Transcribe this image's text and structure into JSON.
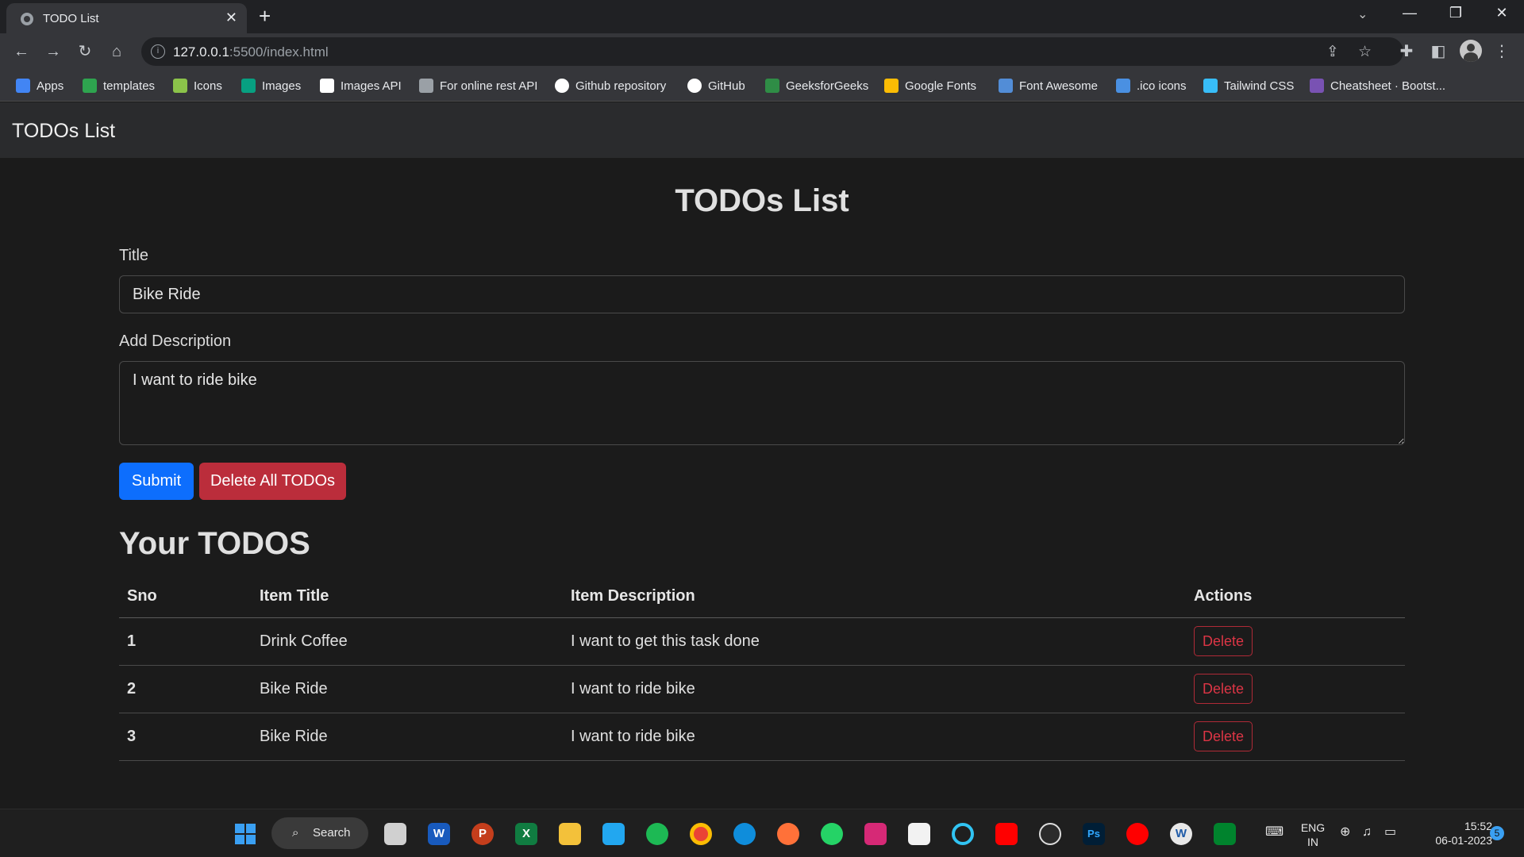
{
  "browser": {
    "tab_title": "TODO List",
    "url_host": "127.0.0.1",
    "url_path": ":5500/index.html"
  },
  "bookmarks": [
    {
      "label": "Apps",
      "icon": "apps-grid-icon",
      "color": "#4285f4"
    },
    {
      "label": "templates",
      "icon": "templates-icon",
      "color": "#2ea44f"
    },
    {
      "label": "Icons",
      "icon": "icons-site-icon",
      "color": "#8bc34a"
    },
    {
      "label": "Images",
      "icon": "pexels-icon",
      "color": "#07a081"
    },
    {
      "label": "Images API",
      "icon": "unsplash-icon",
      "color": "#ffffff"
    },
    {
      "label": "For online rest API",
      "icon": "api-icon",
      "color": "#9aa0a6"
    },
    {
      "label": "Github repository",
      "icon": "github-icon",
      "color": "#ffffff"
    },
    {
      "label": "GitHub",
      "icon": "github-icon",
      "color": "#ffffff"
    },
    {
      "label": "GeeksforGeeks",
      "icon": "geeksforgeeks-icon",
      "color": "#2f8d46"
    },
    {
      "label": "Google Fonts",
      "icon": "google-fonts-icon",
      "color": "#fbbc04"
    },
    {
      "label": "Font Awesome",
      "icon": "font-awesome-flag-icon",
      "color": "#528dd7"
    },
    {
      "label": ".ico icons",
      "icon": "ico-icons-icon",
      "color": "#4a90e2"
    },
    {
      "label": "Tailwind CSS",
      "icon": "tailwind-icon",
      "color": "#38bdf8"
    },
    {
      "label": "Cheatsheet · Bootst...",
      "icon": "bootstrap-icon",
      "color": "#7952b3"
    }
  ],
  "app": {
    "brand": "TODOs List",
    "heading": "TODOs List",
    "title_label": "Title",
    "title_value": "Bike Ride",
    "desc_label": "Add Description",
    "desc_value": "I want to ride bike",
    "submit_label": "Submit",
    "delete_all_label": "Delete All TODOs",
    "list_heading": "Your TODOS",
    "columns": [
      "Sno",
      "Item Title",
      "Item Description",
      "Actions"
    ],
    "rows": [
      {
        "sno": "1",
        "title": "Drink Coffee",
        "desc": "I want to get this task done",
        "action": "Delete"
      },
      {
        "sno": "2",
        "title": "Bike Ride",
        "desc": "I want to ride bike",
        "action": "Delete"
      },
      {
        "sno": "3",
        "title": "Bike Ride",
        "desc": "I want to ride bike",
        "action": "Delete"
      }
    ],
    "colors": {
      "primary": "#0d6efd",
      "danger": "#bb2d3b",
      "danger_text": "#dc3545"
    }
  },
  "taskbar": {
    "search_label": "Search",
    "apps": [
      {
        "name": "windows-start-icon",
        "glyph": "",
        "color": "#3aa0f3"
      },
      {
        "name": "task-view-icon",
        "glyph": "",
        "color": "#d0d0d0"
      },
      {
        "name": "word-icon",
        "glyph": "W",
        "color": "#185abd"
      },
      {
        "name": "powerpoint-icon",
        "glyph": "P",
        "color": "#c43e1c"
      },
      {
        "name": "excel-icon",
        "glyph": "X",
        "color": "#107c41"
      },
      {
        "name": "file-explorer-icon",
        "glyph": "",
        "color": "#f3c13a"
      },
      {
        "name": "vscode-icon",
        "glyph": "",
        "color": "#22a7f0"
      },
      {
        "name": "spotify-icon",
        "glyph": "",
        "color": "#1db954"
      },
      {
        "name": "chrome-icon",
        "glyph": "",
        "color": "#ea4335"
      },
      {
        "name": "edge-icon",
        "glyph": "",
        "color": "#0f8ddb"
      },
      {
        "name": "firefox-icon",
        "glyph": "",
        "color": "#ff7139"
      },
      {
        "name": "whatsapp-icon",
        "glyph": "",
        "color": "#25d366"
      },
      {
        "name": "instagram-icon",
        "glyph": "",
        "color": "#d62976"
      },
      {
        "name": "ms-store-icon",
        "glyph": "",
        "color": "#f2f2f2"
      },
      {
        "name": "alexa-icon",
        "glyph": "",
        "color": "#31c4f3"
      },
      {
        "name": "youtube-icon",
        "glyph": "",
        "color": "#ff0000"
      },
      {
        "name": "camera-icon",
        "glyph": "",
        "color": "#2b2b2b"
      },
      {
        "name": "photoshop-icon",
        "glyph": "Ps",
        "color": "#001e36"
      },
      {
        "name": "youtube-music-icon",
        "glyph": "",
        "color": "#ff0000"
      },
      {
        "name": "wordpad-icon",
        "glyph": "W",
        "color": "#e8e8e8"
      },
      {
        "name": "meet-icon",
        "glyph": "",
        "color": "#00832d"
      }
    ],
    "lang_top": "ENG",
    "lang_bottom": "IN",
    "time": "15:52",
    "date": "06-01-2023",
    "notification_count": "5"
  }
}
